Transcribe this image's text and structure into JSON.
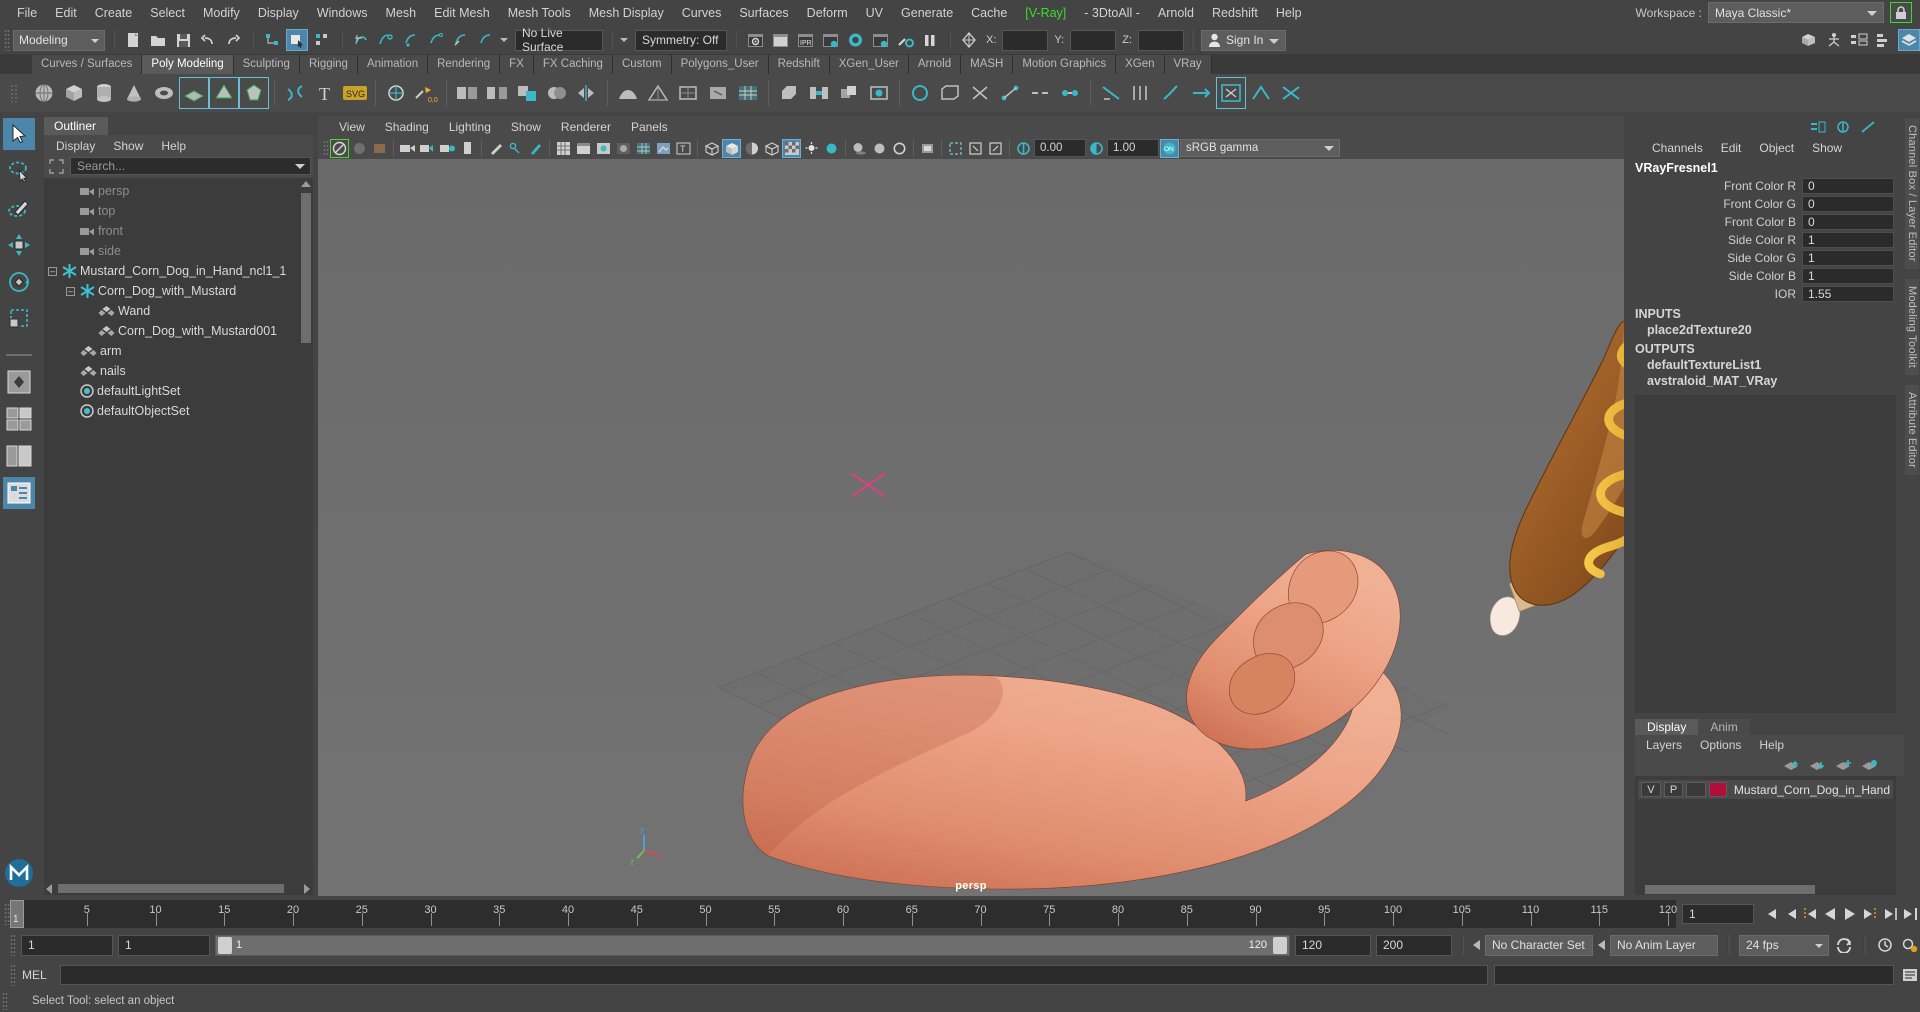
{
  "menubar": {
    "items": [
      "File",
      "Edit",
      "Create",
      "Select",
      "Modify",
      "Display",
      "Windows",
      "Mesh",
      "Edit Mesh",
      "Mesh Tools",
      "Mesh Display",
      "Curves",
      "Surfaces",
      "Deform",
      "UV",
      "Generate",
      "Cache",
      "[V-Ray]",
      "- 3DtoAll -",
      "Arnold",
      "Redshift",
      "Help"
    ],
    "workspace_label": "Workspace :",
    "workspace_value": "Maya Classic*"
  },
  "statusline": {
    "menuset": "Modeling",
    "live_surface": "No Live Surface",
    "symmetry": "Symmetry: Off",
    "axis_x": "X:",
    "axis_y": "Y:",
    "axis_z": "Z:",
    "coord_x": "",
    "coord_y": "",
    "coord_z": "",
    "signin": "Sign In"
  },
  "shelf": {
    "tabs": [
      "Curves / Surfaces",
      "Poly Modeling",
      "Sculpting",
      "Rigging",
      "Animation",
      "Rendering",
      "FX",
      "FX Caching",
      "Custom",
      "Polygons_User",
      "Redshift",
      "XGen_User",
      "Arnold",
      "MASH",
      "Motion Graphics",
      "XGen",
      "VRay"
    ],
    "active_tab": "Poly Modeling"
  },
  "outliner": {
    "tab": "Outliner",
    "menus": [
      "Display",
      "Show",
      "Help"
    ],
    "search_placeholder": "Search...",
    "items": [
      {
        "label": "persp",
        "type": "camera",
        "depth": 1,
        "dim": true
      },
      {
        "label": "top",
        "type": "camera",
        "depth": 1,
        "dim": true
      },
      {
        "label": "front",
        "type": "camera",
        "depth": 1,
        "dim": true
      },
      {
        "label": "side",
        "type": "camera",
        "depth": 1,
        "dim": true
      },
      {
        "label": "Mustard_Corn_Dog_in_Hand_ncl1_1",
        "type": "nucleus",
        "depth": 0,
        "dim": false
      },
      {
        "label": "Corn_Dog_with_Mustard",
        "type": "nucleus",
        "depth": 1,
        "dim": false
      },
      {
        "label": "Wand",
        "type": "mesh",
        "depth": 2,
        "dim": false
      },
      {
        "label": "Corn_Dog_with_Mustard001",
        "type": "mesh",
        "depth": 2,
        "dim": false
      },
      {
        "label": "arm",
        "type": "mesh",
        "depth": 1,
        "dim": false
      },
      {
        "label": "nails",
        "type": "mesh",
        "depth": 1,
        "dim": false
      },
      {
        "label": "defaultLightSet",
        "type": "set",
        "depth": 1,
        "dim": false
      },
      {
        "label": "defaultObjectSet",
        "type": "set",
        "depth": 1,
        "dim": false
      }
    ]
  },
  "viewport": {
    "menus": [
      "View",
      "Shading",
      "Lighting",
      "Show",
      "Renderer",
      "Panels"
    ],
    "exposure": "0.00",
    "gamma": "1.00",
    "color_profile": "sRGB gamma",
    "camera_label": "persp"
  },
  "channelbox": {
    "menus": [
      "Channels",
      "Edit",
      "Object",
      "Show"
    ],
    "node_name": "VRayFresnel1",
    "attributes": [
      {
        "name": "Front Color R",
        "value": "0"
      },
      {
        "name": "Front Color G",
        "value": "0"
      },
      {
        "name": "Front Color B",
        "value": "0"
      },
      {
        "name": "Side Color R",
        "value": "1"
      },
      {
        "name": "Side Color G",
        "value": "1"
      },
      {
        "name": "Side Color B",
        "value": "1"
      },
      {
        "name": "IOR",
        "value": "1.55"
      }
    ],
    "inputs_header": "INPUTS",
    "inputs": [
      "place2dTexture20"
    ],
    "outputs_header": "OUTPUTS",
    "outputs": [
      "defaultTextureList1",
      "avstraloid_MAT_VRay"
    ]
  },
  "layereditor": {
    "tabs": [
      "Display",
      "Anim"
    ],
    "active_tab": "Display",
    "menus": [
      "Layers",
      "Options",
      "Help"
    ],
    "rows": [
      {
        "v": "V",
        "p": "P",
        "third": "",
        "color": "#b01038",
        "name": "Mustard_Corn_Dog_in_Hand"
      }
    ]
  },
  "sidebar_tabs": [
    "Channel Box / Layer Editor",
    "Modeling Toolkit",
    "Attribute Editor"
  ],
  "timeline": {
    "ticks": [
      5,
      10,
      15,
      20,
      25,
      30,
      35,
      40,
      45,
      50,
      55,
      60,
      65,
      70,
      75,
      80,
      85,
      90,
      95,
      100,
      105,
      110,
      115,
      120
    ],
    "current_frame": "1",
    "current_frame_field": "1",
    "range_start": "1",
    "range_end": "1",
    "slider_min": "1",
    "slider_max": "120",
    "anim_start": "120",
    "anim_end": "200",
    "character_set": "No Character Set",
    "anim_layer": "No Anim Layer",
    "fps": "24 fps"
  },
  "command": {
    "label": "MEL",
    "input": "",
    "output": ""
  },
  "helpline": {
    "text": "Select Tool: select an object"
  },
  "colors": {
    "accent_blue": "#4d86ab",
    "teal": "#39b9c8",
    "green": "#3dd92a",
    "layer_red": "#b01038",
    "panel_bg": "#444444",
    "field_bg": "#2b2b2b"
  }
}
